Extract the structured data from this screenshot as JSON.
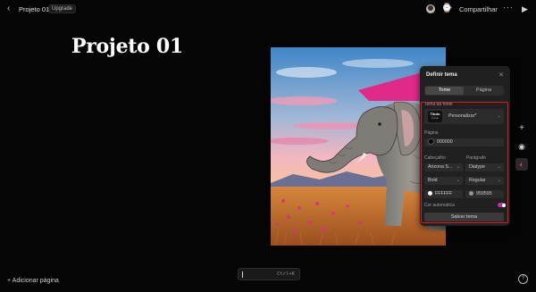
{
  "topbar": {
    "back_icon": "chevron-left-icon",
    "project_name": "Projeto 01",
    "upgrade_label": "Upgrade",
    "share_label": "Compartilhar",
    "more_label": "···",
    "play_icon": "play-icon"
  },
  "canvas": {
    "title": "Projeto 01"
  },
  "theme_panel": {
    "title": "Definir tema",
    "tabs": [
      {
        "label": "Tome",
        "active": true
      },
      {
        "label": "Página",
        "active": false
      }
    ],
    "font_theme_label": "Tema da fonte",
    "font_thumb_title": "Título",
    "font_thumb_sub": "Corpo",
    "font_theme_value": "Personalizar*",
    "page_label": "Página",
    "page_color": "000000",
    "heading_label": "Cabeçalho",
    "paragraph_label": "Parágrafo",
    "heading_font": "Arizona S...",
    "paragraph_font": "Diatype",
    "heading_weight": "Bold",
    "paragraph_weight": "Regular",
    "heading_color": "FFFFFF",
    "paragraph_color": "959595",
    "auto_color_label": "Cor automática",
    "auto_color_on": true,
    "save_label": "Salvar tema"
  },
  "colors": {
    "accent": "#b3369e",
    "highlight_border": "#e01b1b",
    "page_swatch": "#000000",
    "heading_swatch": "#FFFFFF",
    "paragraph_swatch": "#959595"
  },
  "bottombar": {
    "add_page_label": "+ Adicionar página",
    "shortcut": "Ctrl+K",
    "help_label": "?"
  },
  "right_tools": [
    {
      "icon": "plus-icon",
      "symbol": "+"
    },
    {
      "icon": "record-icon",
      "symbol": "◉"
    },
    {
      "icon": "palette-icon",
      "symbol": "◐"
    }
  ]
}
